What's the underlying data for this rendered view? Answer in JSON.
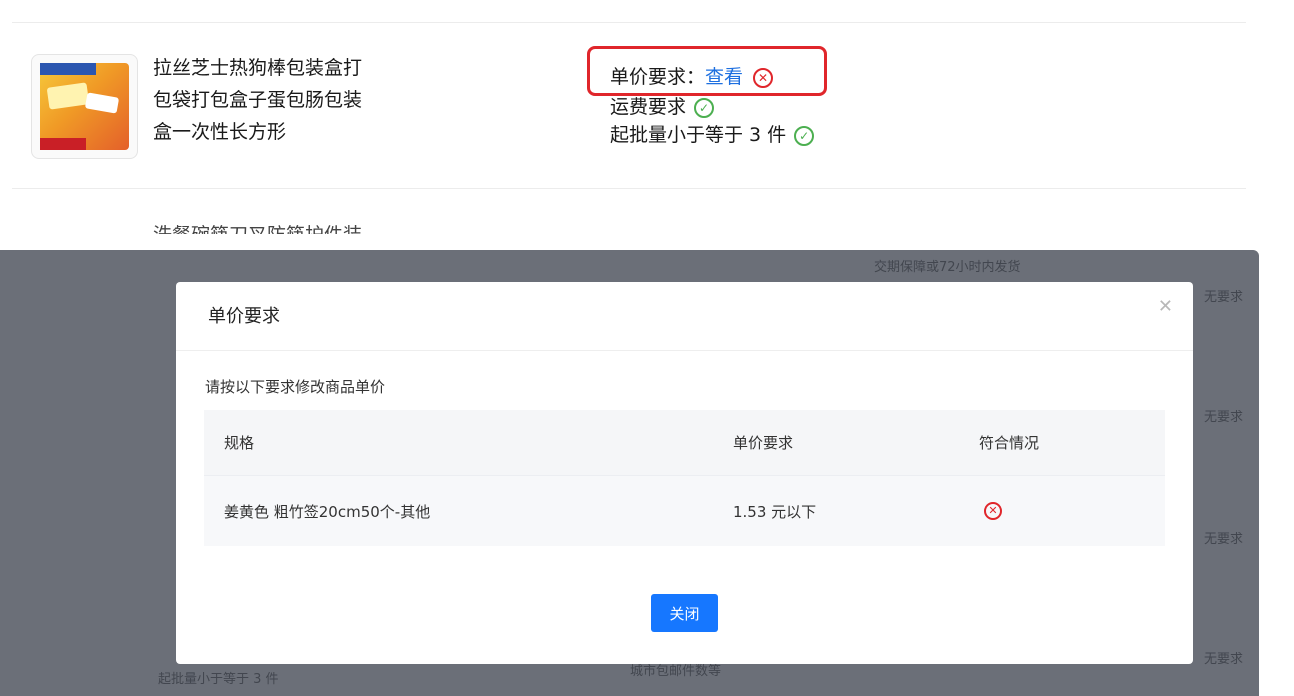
{
  "product": {
    "title_lines": [
      "拉丝芝士热狗棒包装盒打",
      "包袋打包盒子蛋包肠包装",
      "盒一次性长方形"
    ],
    "unit_price_label": "单价要求：",
    "unit_price_link": "查看",
    "shipping_label": "运费要求",
    "min_batch_label": "起批量小于等于 3 件",
    "next_title": "洗餐碗筷刀叉防筷护件装"
  },
  "background_rows": {
    "delivery_text": "交期保障或72小时内发货",
    "no_req_labels": [
      "无要求",
      "无要求",
      "无要求",
      "无要求"
    ],
    "bottom_batch_text": "起批量小于等于 3 件",
    "bottom_mid_text": "城市包邮件数等"
  },
  "modal": {
    "title": "单价要求",
    "hint": "请按以下要求修改商品单价",
    "columns": [
      "规格",
      "单价要求",
      "符合情况"
    ],
    "rows": [
      {
        "spec": "姜黄色 粗竹签20cm50个-其他",
        "price_req": "1.53 元以下",
        "status": "fail"
      }
    ],
    "close_button": "关闭"
  },
  "colors": {
    "accent": "#1677ff",
    "error": "#e0262b",
    "ok": "#4caf50",
    "highlight_border": "#e0262b"
  }
}
